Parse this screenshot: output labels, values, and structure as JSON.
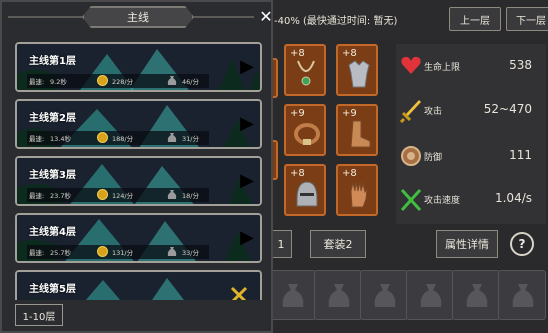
{
  "header": {
    "best_info": "-40%  (最快通过时间: 暂无)",
    "prev_label": "上一层",
    "next_label": "下一层"
  },
  "equipment": {
    "slots": [
      {
        "plus": "+8",
        "icon": "necklace-icon"
      },
      {
        "plus": "+8",
        "icon": "armor-icon"
      },
      {
        "plus": "+9",
        "icon": "belt-icon"
      },
      {
        "plus": "+9",
        "icon": "boots-icon"
      },
      {
        "plus": "+8",
        "icon": "helmet-icon"
      },
      {
        "plus": "+8",
        "icon": "glove-icon"
      }
    ]
  },
  "stats": [
    {
      "label": "生命上限",
      "value": "538",
      "icon": "heart-icon",
      "color": "#e0343a"
    },
    {
      "label": "攻击",
      "value": "52~470",
      "icon": "sword-icon",
      "color": "#e6b52a"
    },
    {
      "label": "防御",
      "value": "111",
      "icon": "shield-icon",
      "color": "#b07850"
    },
    {
      "label": "攻击速度",
      "value": "1.04/s",
      "icon": "crossed-arrows-icon",
      "color": "#3fbf3f"
    }
  ],
  "tabs": {
    "suit1": "1",
    "suit2": "套装2",
    "detail": "属性详情",
    "help": "?"
  },
  "modal": {
    "title": "主线",
    "close": "✕",
    "range": "1-10层",
    "levels": [
      {
        "name": "主线第1层",
        "fast_label": "最速:",
        "time": "9.2秒",
        "gold": "228/分",
        "items": "46/分"
      },
      {
        "name": "主线第2层",
        "fast_label": "最速:",
        "time": "13.4秒",
        "gold": "188/分",
        "items": "31/分"
      },
      {
        "name": "主线第3层",
        "fast_label": "最速:",
        "time": "23.7秒",
        "gold": "124/分",
        "items": "18/分"
      },
      {
        "name": "主线第4层",
        "fast_label": "最速:",
        "time": "25.7秒",
        "gold": "131/分",
        "items": "33/分"
      },
      {
        "name": "主线第5层",
        "fast_label": "",
        "time": "",
        "gold": "",
        "items": ""
      }
    ]
  },
  "colors": {
    "slot_fill": "#7a3d16",
    "slot_border": "#c2692a",
    "gold": "#d8a21c",
    "teal_art": "#2f8f8a"
  }
}
